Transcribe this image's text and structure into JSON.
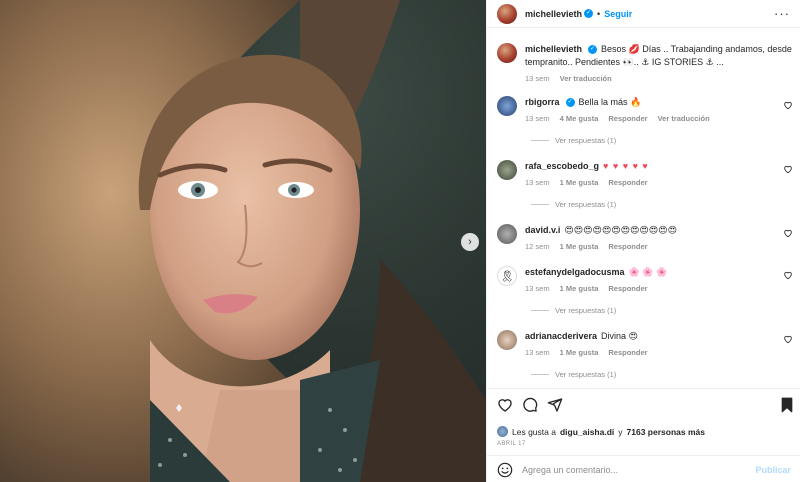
{
  "post": {
    "photo_alt": "",
    "next_arrow": "›"
  },
  "header": {
    "username": "michellevieth",
    "verified_mark": "✓",
    "separator": "•",
    "follow_label": "Seguir",
    "more_label": "···"
  },
  "caption": {
    "username": "michellevieth",
    "text": "Besos 💋 Días .. Trabajanding andamos, desde tempranito.. Pendientes 👀.. ⚓ IG STORIES ⚓ ...",
    "time": "13 sem",
    "translate": "Ver traducción"
  },
  "comments": [
    {
      "username": "rbigorra",
      "verified": true,
      "text": "Bella la más 🔥",
      "time": "13 sem",
      "likes": "4 Me gusta",
      "reply": "Responder",
      "translate": "Ver traducción",
      "replies": "Ver respuestas (1)"
    },
    {
      "username": "rafa_escobedo_g",
      "verified": false,
      "text": "♥ ♥ ♥ ♥ ♥",
      "time": "13 sem",
      "likes": "1 Me gusta",
      "reply": "Responder",
      "replies": "Ver respuestas (1)"
    },
    {
      "username": "david.v.i",
      "verified": false,
      "text": "😍😍😍😍😍😍😍😍😍😍😍😍",
      "time": "12 sem",
      "likes": "1 Me gusta",
      "reply": "Responder"
    },
    {
      "username": "estefanydelgadocusma",
      "verified": false,
      "text": "🌸 🌸 🌸",
      "time": "13 sem",
      "likes": "1 Me gusta",
      "reply": "Responder",
      "replies": "Ver respuestas (1)"
    },
    {
      "username": "adrianacderivera",
      "verified": false,
      "text": "Divina 😍",
      "time": "13 sem",
      "likes": "1 Me gusta",
      "reply": "Responder",
      "replies": "Ver respuestas (1)"
    }
  ],
  "likes_bar": {
    "prefix": "Les gusta a",
    "first_user": "digu_aisha.di",
    "joiner": "y",
    "others": "7163 personas más"
  },
  "date": "ABRIL 17",
  "composer": {
    "placeholder": "Agrega un comentario...",
    "publish_label": "Publicar"
  },
  "colors": {
    "accent": "#0095f6",
    "like_red": "#ed4956",
    "muted": "#8e8e8e"
  }
}
